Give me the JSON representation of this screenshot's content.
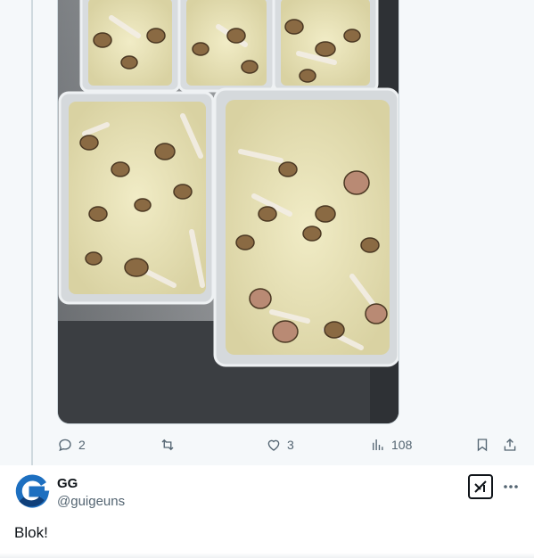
{
  "tweet_media": {
    "alt": "Plastic containers of chicken with mushroom sauce"
  },
  "actions": {
    "replies": "2",
    "retweets": "",
    "likes": "3",
    "views": "108"
  },
  "next_tweet": {
    "display_name": "GG",
    "handle": "@guigeuns",
    "text": "Blok!",
    "avatar_letter": "G"
  },
  "colors": {
    "accent_blue": "#1d6fc0",
    "muted": "#536471"
  }
}
